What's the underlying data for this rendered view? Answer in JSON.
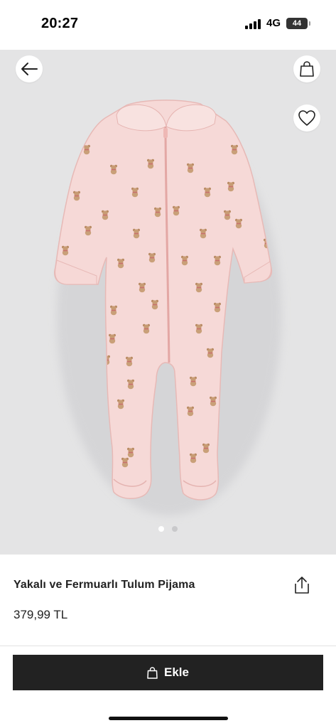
{
  "status_bar": {
    "time": "20:27",
    "network": "4G",
    "battery": "44",
    "icons": [
      "cellular-signal-icon",
      "battery-icon"
    ]
  },
  "gallery": {
    "background_color": "#e4e4e5",
    "image_subject": "light pink footed sleepsuit with collar, zip and teddy bear print",
    "pages": 2,
    "current_page": 1,
    "icons": [
      "arrow-left-icon",
      "shopping-bag-icon",
      "heart-icon"
    ]
  },
  "product": {
    "title": "Yakalı ve Fermuarlı Tulum Pijama",
    "price": "379,99 TL",
    "share_icon": "share-icon"
  },
  "cta": {
    "label": "Ekle",
    "icon": "shopping-bag-icon",
    "color": "#222222"
  }
}
